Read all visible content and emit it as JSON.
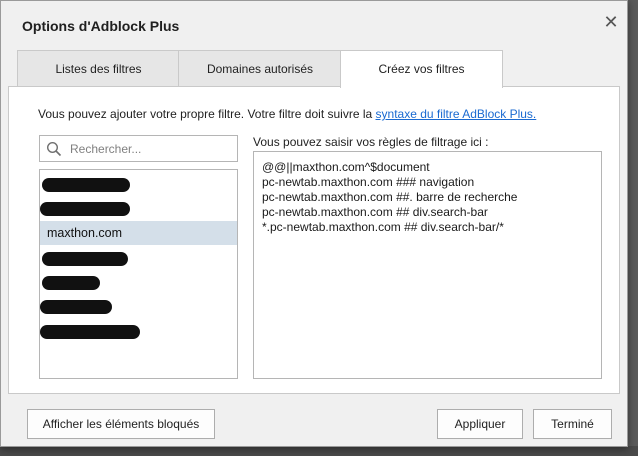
{
  "dialog": {
    "title": "Options d'Adblock Plus",
    "close_icon": "close-icon"
  },
  "tabs": [
    {
      "label": "Listes des filtres",
      "active": false
    },
    {
      "label": "Domaines autorisés",
      "active": false
    },
    {
      "label": "Créez vos filtres",
      "active": true
    }
  ],
  "intro": {
    "text": "Vous pouvez ajouter votre propre filtre. Votre filtre doit suivre la ",
    "link": "syntaxe du filtre AdBlock Plus."
  },
  "search": {
    "placeholder": "Rechercher...",
    "value": "",
    "icon": "search-icon"
  },
  "domain_list": {
    "selected_item": "maxthon.com",
    "redacted_count": 6
  },
  "rules": {
    "label": "Vous pouvez saisir vos règles de filtrage ici :",
    "lines": [
      "@@||maxthon.com^$document",
      "pc-newtab.maxthon.com ### navigation",
      "pc-newtab.maxthon.com ##. barre de recherche",
      "pc-newtab.maxthon.com ## div.search-bar",
      "*.pc-newtab.maxthon.com ## div.search-bar/*"
    ]
  },
  "buttons": {
    "show_blocked": "Afficher les éléments bloqués",
    "apply": "Appliquer",
    "done": "Terminé"
  },
  "colors": {
    "link": "#1a6ad1",
    "selection": "#d4dfe9",
    "dialog_bg": "#f0f0f0"
  }
}
